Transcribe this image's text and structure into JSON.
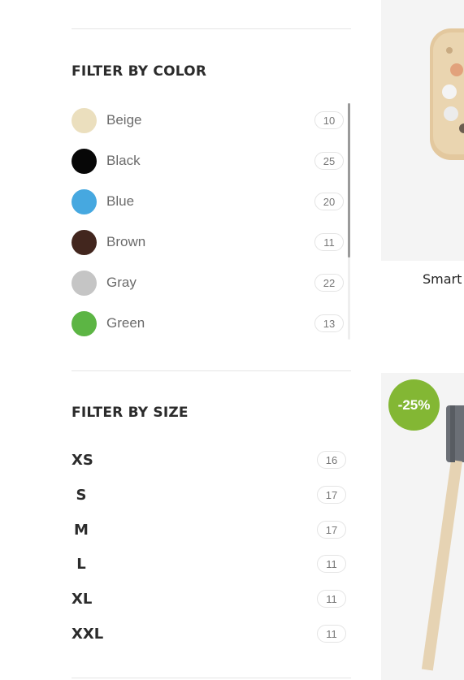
{
  "filter_by_color": {
    "title": "FILTER BY COLOR",
    "items": [
      {
        "label": "Beige",
        "count": "10",
        "color": "#ebdfbe"
      },
      {
        "label": "Black",
        "count": "25",
        "color": "#070707"
      },
      {
        "label": "Blue",
        "count": "20",
        "color": "#46a8e0"
      },
      {
        "label": "Brown",
        "count": "11",
        "color": "#42261e"
      },
      {
        "label": "Gray",
        "count": "22",
        "color": "#c5c5c5"
      },
      {
        "label": "Green",
        "count": "13",
        "color": "#5cb544"
      }
    ]
  },
  "filter_by_size": {
    "title": "FILTER BY SIZE",
    "items": [
      {
        "label": "XS",
        "count": "16"
      },
      {
        "label": "S",
        "count": "17"
      },
      {
        "label": "M",
        "count": "17"
      },
      {
        "label": "L",
        "count": "11"
      },
      {
        "label": "XL",
        "count": "11"
      },
      {
        "label": "XXL",
        "count": "11"
      }
    ]
  },
  "products": {
    "first_name": "Smart",
    "second_badge": "-25%",
    "badge_color": "#83b734"
  }
}
